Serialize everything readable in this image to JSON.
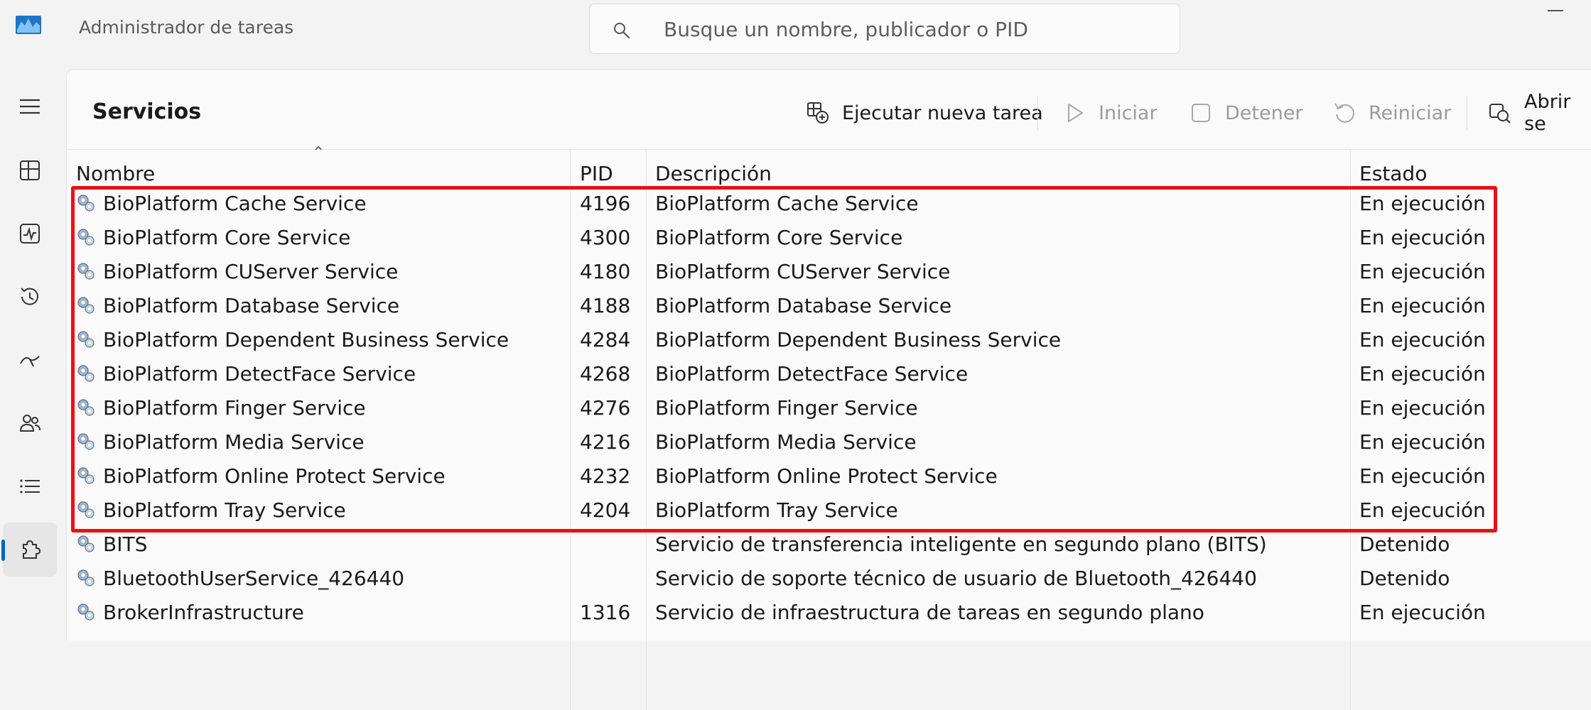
{
  "app": {
    "title": "Administrador de tareas",
    "logo_icon": "task-manager-logo-icon"
  },
  "search": {
    "placeholder": "Busque un nombre, publicador o PID",
    "value": ""
  },
  "sidebar": {
    "items": [
      {
        "name": "hamburger-menu",
        "icon": "menu-icon",
        "active": false
      },
      {
        "name": "processes",
        "icon": "processes-grid-icon",
        "active": false
      },
      {
        "name": "performance",
        "icon": "performance-pulse-icon",
        "active": false
      },
      {
        "name": "app-history",
        "icon": "history-clock-icon",
        "active": false
      },
      {
        "name": "startup-apps",
        "icon": "startup-speedometer-icon",
        "active": false
      },
      {
        "name": "users",
        "icon": "users-icon",
        "active": false
      },
      {
        "name": "details",
        "icon": "details-list-icon",
        "active": false
      },
      {
        "name": "services",
        "icon": "services-puzzle-icon",
        "active": true
      }
    ]
  },
  "page": {
    "title": "Servicios"
  },
  "toolbar": {
    "run_new_task": "Ejecutar nueva tarea",
    "start": "Iniciar",
    "stop": "Detener",
    "restart": "Reiniciar",
    "open_services": "Abrir se"
  },
  "table": {
    "columns": {
      "name": "Nombre",
      "pid": "PID",
      "description": "Descripción",
      "status": "Estado"
    },
    "rows": [
      {
        "name": "BioPlatform Cache Service",
        "pid": "4196",
        "description": "BioPlatform Cache Service",
        "status": "En ejecución"
      },
      {
        "name": "BioPlatform Core Service",
        "pid": "4300",
        "description": "BioPlatform Core Service",
        "status": "En ejecución"
      },
      {
        "name": "BioPlatform CUServer Service",
        "pid": "4180",
        "description": "BioPlatform CUServer Service",
        "status": "En ejecución"
      },
      {
        "name": "BioPlatform Database Service",
        "pid": "4188",
        "description": "BioPlatform Database Service",
        "status": "En ejecución"
      },
      {
        "name": "BioPlatform Dependent Business Service",
        "pid": "4284",
        "description": "BioPlatform Dependent Business Service",
        "status": "En ejecución"
      },
      {
        "name": "BioPlatform DetectFace Service",
        "pid": "4268",
        "description": "BioPlatform DetectFace Service",
        "status": "En ejecución"
      },
      {
        "name": "BioPlatform Finger Service",
        "pid": "4276",
        "description": "BioPlatform Finger Service",
        "status": "En ejecución"
      },
      {
        "name": "BioPlatform Media Service",
        "pid": "4216",
        "description": "BioPlatform Media Service",
        "status": "En ejecución"
      },
      {
        "name": "BioPlatform Online Protect Service",
        "pid": "4232",
        "description": "BioPlatform Online Protect Service",
        "status": "En ejecución"
      },
      {
        "name": "BioPlatform Tray Service",
        "pid": "4204",
        "description": "BioPlatform Tray Service",
        "status": "En ejecución"
      },
      {
        "name": "BITS",
        "pid": "",
        "description": "Servicio de transferencia inteligente en segundo plano (BITS)",
        "status": "Detenido"
      },
      {
        "name": "BluetoothUserService_426440",
        "pid": "",
        "description": "Servicio de soporte técnico de usuario de Bluetooth_426440",
        "status": "Detenido"
      },
      {
        "name": "BrokerInfrastructure",
        "pid": "1316",
        "description": "Servicio de infraestructura de tareas en segundo plano",
        "status": "En ejecución"
      }
    ]
  },
  "colors": {
    "highlight": "#ec0f15",
    "accent": "#0067c0"
  }
}
